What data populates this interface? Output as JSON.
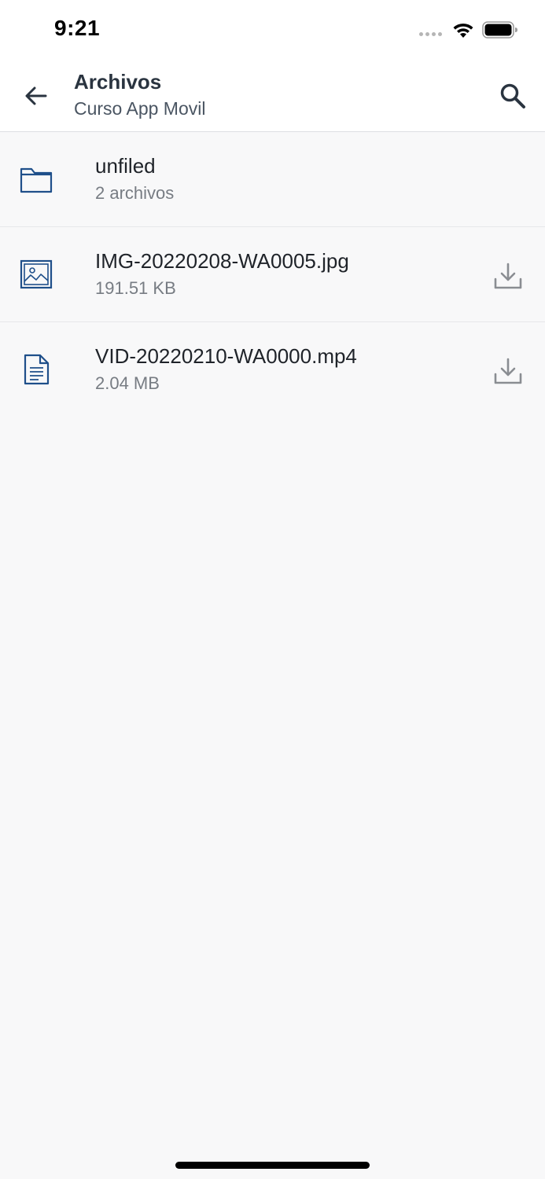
{
  "status_bar": {
    "time": "9:21"
  },
  "header": {
    "title": "Archivos",
    "subtitle": "Curso App Movil",
    "back_icon": "arrow-left-icon",
    "search_icon": "search-icon"
  },
  "files": [
    {
      "name": "unfiled",
      "meta": "2 archivos",
      "icon": "folder-icon",
      "downloadable": false
    },
    {
      "name": "IMG-20220208-WA0005.jpg",
      "meta": "191.51 KB",
      "icon": "image-icon",
      "downloadable": true
    },
    {
      "name": "VID-20220210-WA0000.mp4",
      "meta": "2.04 MB",
      "icon": "document-icon",
      "downloadable": true
    }
  ],
  "colors": {
    "file_icon": "#1f4f8a",
    "header_text": "#2a3440",
    "download_icon": "#8a8d92",
    "background": "#f8f8f9"
  }
}
